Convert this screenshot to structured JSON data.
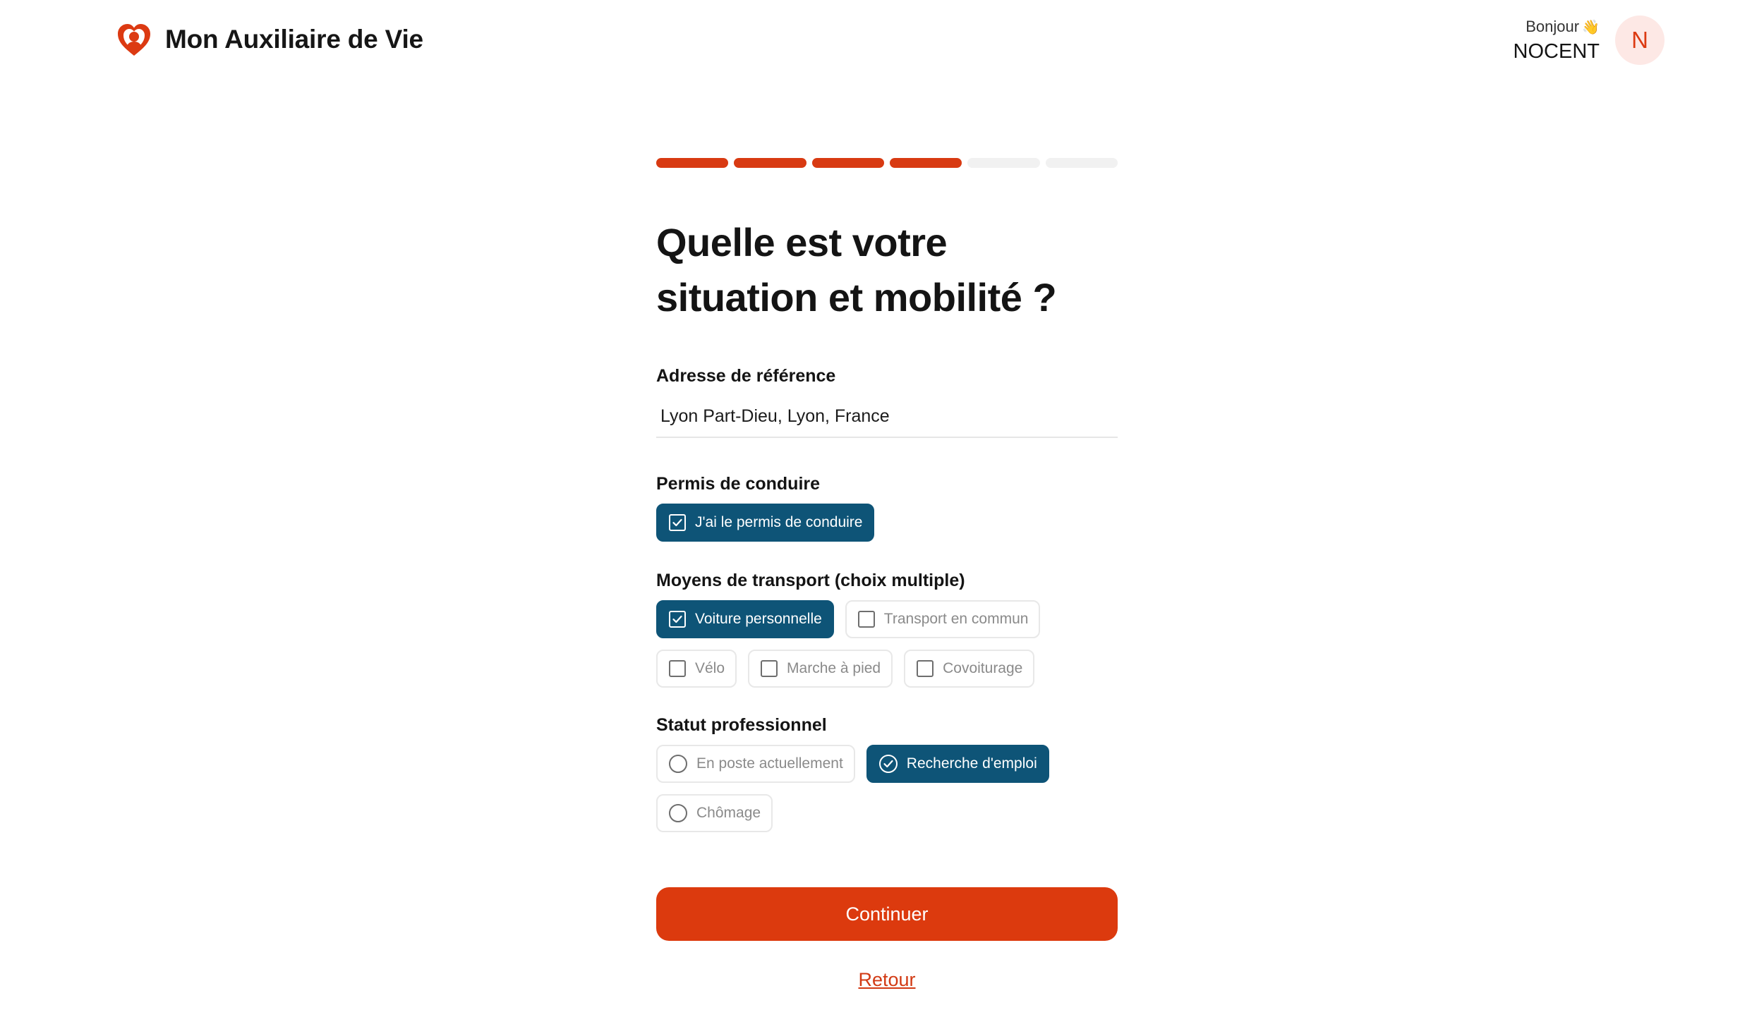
{
  "brand": {
    "name": "Mon Auxiliaire de Vie",
    "logo_icon": "heart-person-icon",
    "color": "#dc3a12"
  },
  "user": {
    "greeting": "Bonjour",
    "greeting_emoji": "👋",
    "name": "NOCENT",
    "initial": "N"
  },
  "progress": {
    "total_steps": 6,
    "completed_steps": 4,
    "done_color": "#d83a12",
    "todo_color": "#f1f1f1"
  },
  "form": {
    "title_line1": "Quelle est votre",
    "title_line2": "situation et mobilité ?",
    "address": {
      "label": "Adresse de référence",
      "value": "Lyon Part-Dieu, Lyon, France"
    },
    "permis": {
      "label": "Permis de conduire",
      "options": [
        {
          "label": "J'ai le permis de conduire",
          "selected": true
        }
      ]
    },
    "transport": {
      "label": "Moyens de transport (choix multiple)",
      "options": [
        {
          "label": "Voiture personnelle",
          "selected": true
        },
        {
          "label": "Transport en commun",
          "selected": false
        },
        {
          "label": "Vélo",
          "selected": false
        },
        {
          "label": "Marche à pied",
          "selected": false
        },
        {
          "label": "Covoiturage",
          "selected": false
        }
      ]
    },
    "statut": {
      "label": "Statut professionnel",
      "options": [
        {
          "label": "En poste actuellement",
          "selected": false
        },
        {
          "label": "Recherche d'emploi",
          "selected": true
        },
        {
          "label": "Chômage",
          "selected": false
        }
      ]
    }
  },
  "actions": {
    "continue_label": "Continuer",
    "back_label": "Retour"
  },
  "colors": {
    "accent": "#dc3a0e",
    "selected_chip": "#0e5477"
  }
}
